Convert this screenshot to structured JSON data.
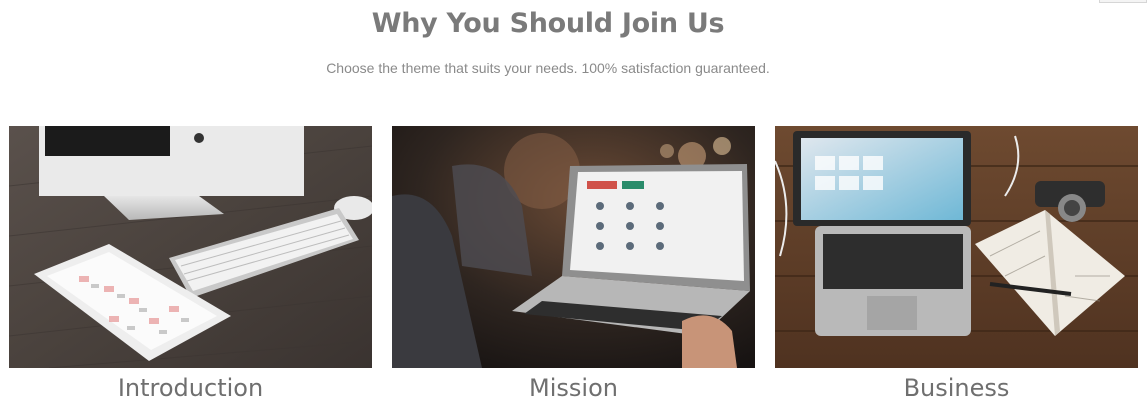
{
  "section": {
    "title": "Why You Should Join Us",
    "subtitle": "Choose the theme that suits your needs. 100% satisfaction guaranteed."
  },
  "cards": [
    {
      "title": "Introduction",
      "image": "desk-imac-ipad-keyboard-photo"
    },
    {
      "title": "Mission",
      "image": "person-using-laptop-photo"
    },
    {
      "title": "Business",
      "image": "macbook-notebook-wooden-desk-photo"
    }
  ]
}
